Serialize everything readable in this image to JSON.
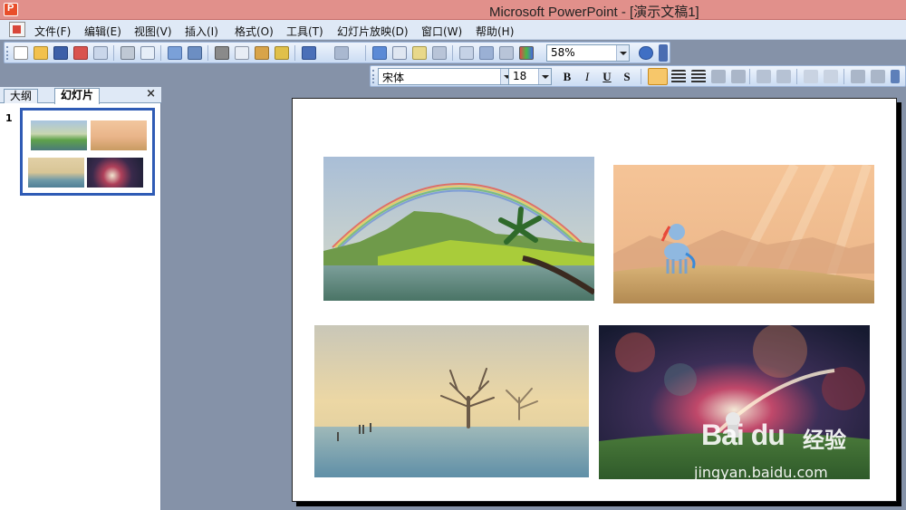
{
  "window": {
    "title": "Microsoft PowerPoint - [演示文稿1]"
  },
  "menu": {
    "items": [
      "文件(F)",
      "编辑(E)",
      "视图(V)",
      "插入(I)",
      "格式(O)",
      "工具(T)",
      "幻灯片放映(D)",
      "窗口(W)",
      "帮助(H)"
    ]
  },
  "toolbar": {
    "zoom": "58%",
    "font_name": "宋体",
    "font_size": "18",
    "bold": "B",
    "italic": "I",
    "underline": "U",
    "shadow": "S"
  },
  "pane": {
    "tabs": [
      "大纲",
      "幻灯片"
    ],
    "active_tab": "幻灯片",
    "close": "×",
    "slide_number": "1"
  },
  "watermark": {
    "brand": "Bai du",
    "cn": "经验",
    "url": "jingyan.baidu.com"
  },
  "colors": {
    "titlebar": "#e1908b",
    "menubar": "#dfe9f6",
    "workspace": "#8592a8",
    "selection": "#2f5bb5"
  },
  "slide": {
    "pictures": [
      "rainbow-lake-palm",
      "pony-field-sunset",
      "misty-frost-trees",
      "space-nebula-astronaut"
    ]
  }
}
